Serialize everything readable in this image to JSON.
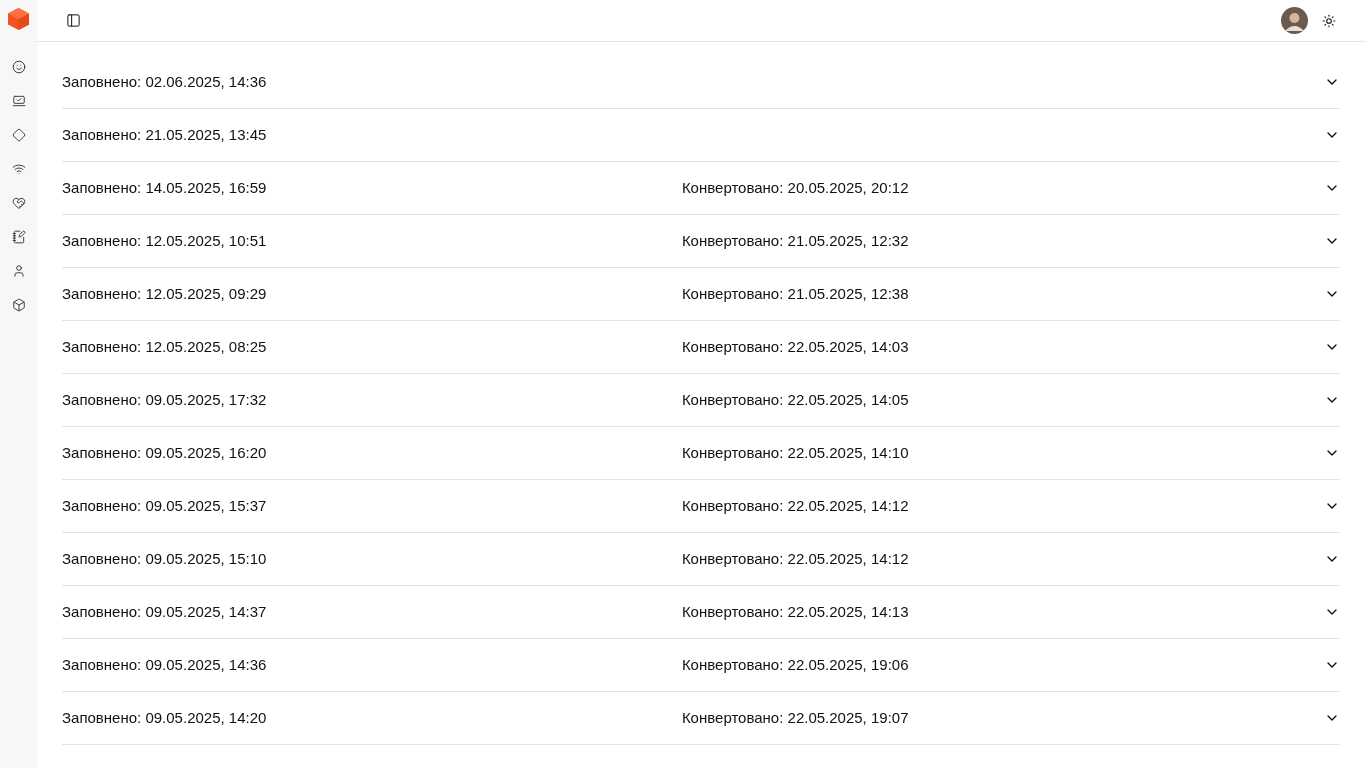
{
  "rows": [
    {
      "filled": "Заповнено: 02.06.2025, 14:36"
    },
    {
      "filled": "Заповнено: 21.05.2025, 13:45"
    },
    {
      "filled": "Заповнено: 14.05.2025, 16:59",
      "converted": "Конвертовано: 20.05.2025, 20:12"
    },
    {
      "filled": "Заповнено: 12.05.2025, 10:51",
      "converted": "Конвертовано: 21.05.2025, 12:32"
    },
    {
      "filled": "Заповнено: 12.05.2025, 09:29",
      "converted": "Конвертовано: 21.05.2025, 12:38"
    },
    {
      "filled": "Заповнено: 12.05.2025, 08:25",
      "converted": "Конвертовано: 22.05.2025, 14:03"
    },
    {
      "filled": "Заповнено: 09.05.2025, 17:32",
      "converted": "Конвертовано: 22.05.2025, 14:05"
    },
    {
      "filled": "Заповнено: 09.05.2025, 16:20",
      "converted": "Конвертовано: 22.05.2025, 14:10"
    },
    {
      "filled": "Заповнено: 09.05.2025, 15:37",
      "converted": "Конвертовано: 22.05.2025, 14:12"
    },
    {
      "filled": "Заповнено: 09.05.2025, 15:10",
      "converted": "Конвертовано: 22.05.2025, 14:12"
    },
    {
      "filled": "Заповнено: 09.05.2025, 14:37",
      "converted": "Конвертовано: 22.05.2025, 14:13"
    },
    {
      "filled": "Заповнено: 09.05.2025, 14:36",
      "converted": "Конвертовано: 22.05.2025, 19:06"
    },
    {
      "filled": "Заповнено: 09.05.2025, 14:20",
      "converted": "Конвертовано: 22.05.2025, 19:07"
    }
  ]
}
